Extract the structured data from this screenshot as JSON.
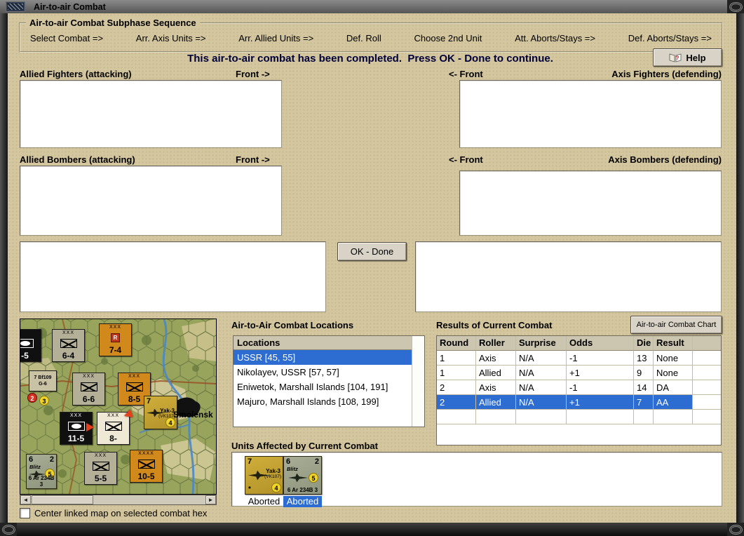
{
  "window": {
    "title": "Air-to-air Combat"
  },
  "icons": {
    "scroll_left": "◄",
    "scroll_right": "►"
  },
  "sequence": {
    "title": "Air-to-air Combat Subphase Sequence",
    "steps": [
      "Select Combat =>",
      "Arr. Axis Units =>",
      "Arr. Allied Units =>",
      "Def. Roll",
      "Choose 2nd Unit",
      "Att. Aborts/Stays =>",
      "Def. Aborts/Stays =>"
    ]
  },
  "message": "This air-to-air combat has been completed.  Press OK - Done to continue.",
  "buttons": {
    "help": "Help",
    "ok_done": "OK - Done",
    "combat_chart": "Air-to-air Combat Chart"
  },
  "labels": {
    "allied_fighters": "Allied Fighters (attacking)",
    "front_arrow_right": "Front ->",
    "front_arrow_left": "<- Front",
    "axis_fighters": "Axis Fighters (defending)",
    "allied_bombers": "Allied Bombers (attacking)",
    "axis_bombers": "Axis Bombers (defending)",
    "locations_title": "Air-to-Air Combat Locations",
    "results_title": "Results of Current Combat",
    "units_title": "Units Affected by Current Combat",
    "center_map_checkbox": "Center linked map on selected combat hex"
  },
  "locations": {
    "header": "Locations",
    "items": [
      "USSR [45, 55]",
      "Nikolayev, USSR [57, 57]",
      "Eniwetok, Marshall Islands [104, 191]",
      "Majuro, Marshall Islands [108, 199]"
    ],
    "selected_index": 0
  },
  "results": {
    "columns": [
      "Round",
      "Roller",
      "Surprise",
      "Odds",
      "Die",
      "Result"
    ],
    "rows": [
      [
        "1",
        "Axis",
        "N/A",
        "-1",
        "13",
        "None"
      ],
      [
        "1",
        "Allied",
        "N/A",
        "+1",
        "9",
        "None"
      ],
      [
        "2",
        "Axis",
        "N/A",
        "-1",
        "14",
        "DA"
      ],
      [
        "2",
        "Allied",
        "N/A",
        "+1",
        "7",
        "AA"
      ]
    ],
    "selected_row": 3
  },
  "units": [
    {
      "attack": "7",
      "name": "Yak-3",
      "variant": "(VK107)",
      "star": "*",
      "rating": "4",
      "status": "Aborted",
      "selected": false
    },
    {
      "attack": "6",
      "defense": "2",
      "name": "Blitz",
      "rating": "5",
      "designation": "6 Ar 234B 3",
      "status": "Aborted",
      "selected": true
    }
  ],
  "map": {
    "city": "Smolensk",
    "counters": [
      {
        "value": "-5"
      },
      {
        "size": "XXX",
        "value": "6-4"
      },
      {
        "size": "XXX",
        "badge": "R",
        "value": "7-4"
      },
      {
        "line1": "7 Bf109",
        "line2": "G-6",
        "badge1": "2",
        "badge2": "3"
      },
      {
        "size": "XXX",
        "value": "6-6"
      },
      {
        "size": "XXX",
        "value": "8-5"
      },
      {
        "size": "XXX",
        "value": "11-5"
      },
      {
        "size": "XXX",
        "value": "8-"
      },
      {
        "attack": "7",
        "name": "Yak-3",
        "variant": "(VK107)",
        "rating": "4"
      },
      {
        "attack": "6",
        "defense": "2",
        "name": "Blitz",
        "rating": "5",
        "designation": "6 Ar 234B 3"
      },
      {
        "size": "XXX",
        "value": "5-5"
      },
      {
        "size": "XXXX",
        "value": "10-5"
      }
    ]
  }
}
